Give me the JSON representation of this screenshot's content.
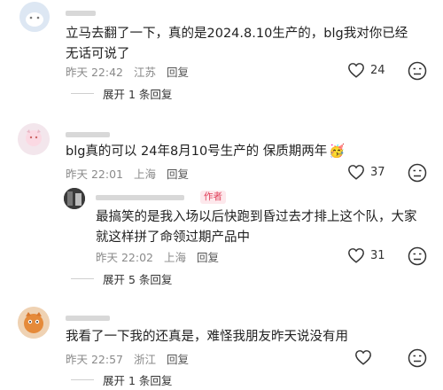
{
  "comments": [
    {
      "text": "立马去翻了一下，真的是2024.8.10生产的，blg我对你已经无话可说了",
      "time": "昨天 22:42",
      "location": "江苏",
      "reply": "回复",
      "likes": "24",
      "expand": "展开 1 条回复"
    },
    {
      "text": "blg真的可以 24年8月10号生产的 保质期两年",
      "emoji": "🥳",
      "time": "昨天 22:01",
      "location": "上海",
      "reply": "回复",
      "likes": "37",
      "sub_reply": {
        "badge": "作者",
        "text": "最搞笑的是我入场以后快跑到昏过去才排上这个队，大家就这样拼了命领过期产品中",
        "time": "昨天 22:02",
        "location": "上海",
        "reply": "回复",
        "likes": "31"
      },
      "expand": "展开 5 条回复"
    },
    {
      "text": "我看了一下我的还真是，难怪我朋友昨天说没有用",
      "time": "昨天 22:57",
      "location": "浙江",
      "reply": "回复",
      "expand": "展开 1 条回复"
    }
  ],
  "icons": {
    "like": "heart-outline-icon",
    "dislike": "dislike-face-icon"
  },
  "colors": {
    "author_badge_text": "#e0405a",
    "author_badge_bg": "#fde8ec"
  }
}
